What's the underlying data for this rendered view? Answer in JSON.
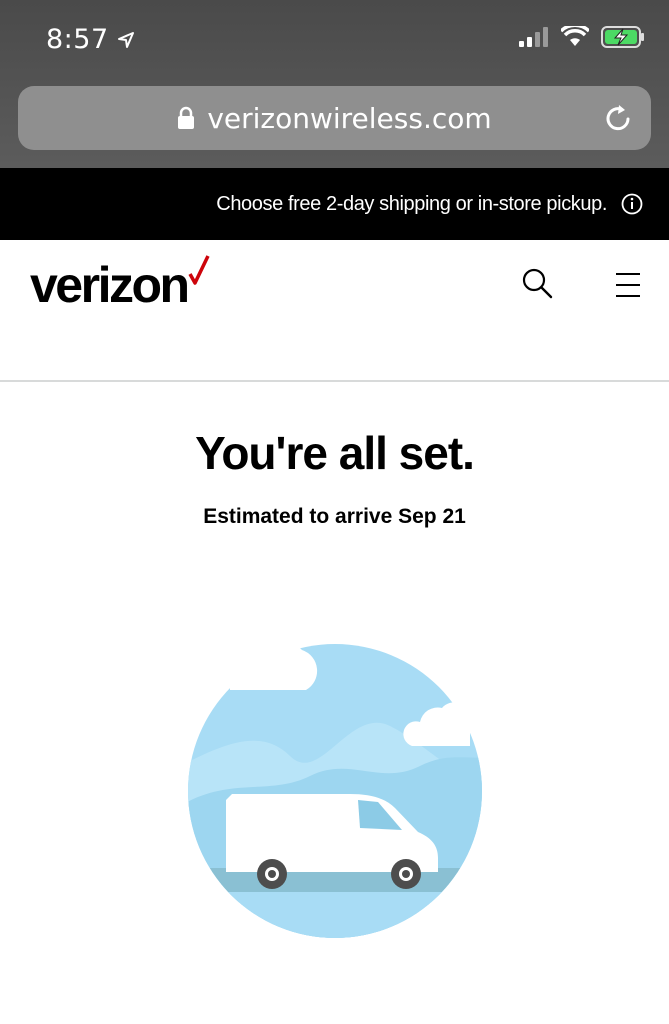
{
  "status_bar": {
    "time": "8:57"
  },
  "browser": {
    "url": "verizonwireless.com"
  },
  "promo": {
    "text": "Choose free 2-day shipping or in-store pickup."
  },
  "header": {
    "logo": "verizon"
  },
  "main": {
    "headline": "You're all set.",
    "subline": "Estimated to arrive Sep 21"
  },
  "colors": {
    "brand_red": "#cd040b",
    "sky": "#a8dcf5",
    "road": "#8ac0d3"
  },
  "icons": [
    "location-arrow-icon",
    "signal-icon",
    "wifi-icon",
    "battery-charging-icon",
    "lock-icon",
    "reload-icon",
    "info-icon",
    "search-icon",
    "menu-icon",
    "delivery-van-icon"
  ]
}
